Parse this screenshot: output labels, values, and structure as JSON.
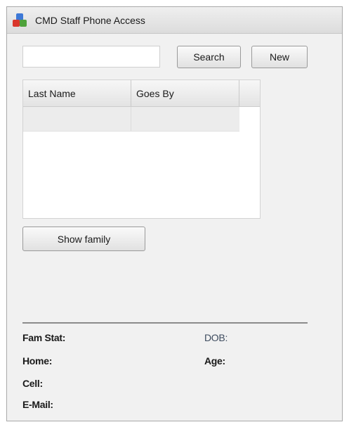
{
  "window": {
    "title": "CMD Staff Phone Access",
    "icon": "app-blocks-icon"
  },
  "search": {
    "value": "",
    "placeholder": "",
    "button_label": "Search"
  },
  "toolbar": {
    "new_label": "New"
  },
  "table": {
    "columns": [
      "Last Name",
      "Goes By"
    ],
    "rows": [
      [
        "",
        ""
      ]
    ]
  },
  "actions": {
    "show_family_label": "Show family"
  },
  "details": {
    "famstat_label": "Fam Stat:",
    "dob_label": "DOB:",
    "home_label": "Home:",
    "age_label": "Age:",
    "cell_label": "Cell:",
    "email_label": "E-Mail:"
  },
  "colors": {
    "window_background": "#f1f1f1",
    "dob_label_color": "#3d4b5e",
    "separator": "#8c8c8c"
  }
}
